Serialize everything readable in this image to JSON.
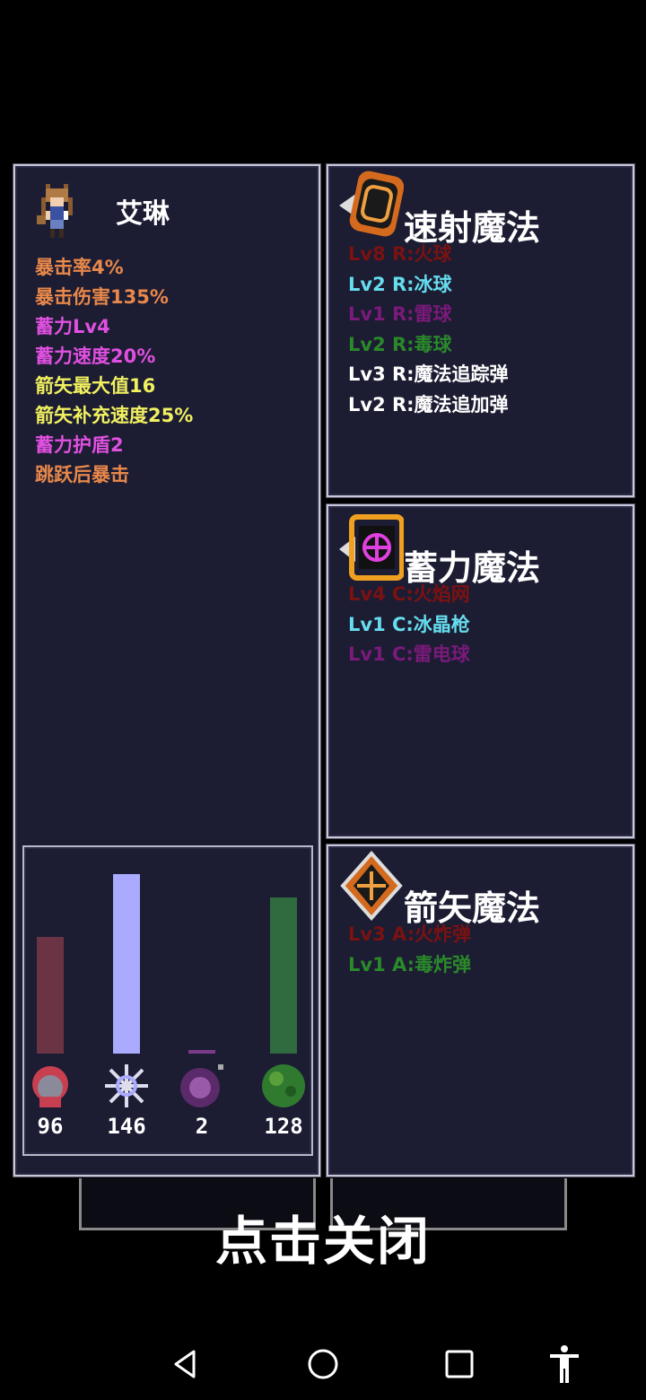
{
  "character": {
    "name": "艾琳",
    "stats": [
      {
        "text": "暴击率4%",
        "color": "#e8884a"
      },
      {
        "text": "暴击伤害135%",
        "color": "#e8884a"
      },
      {
        "text": "蓄力Lv4",
        "color": "#e050e0"
      },
      {
        "text": "蓄力速度20%",
        "color": "#e050e0"
      },
      {
        "text": "箭矢最大值16",
        "color": "#f0f060"
      },
      {
        "text": "箭矢补充速度25%",
        "color": "#f0f060"
      },
      {
        "text": "蓄力护盾2",
        "color": "#e050e0"
      },
      {
        "text": "跳跃后暴击",
        "color": "#e8884a"
      }
    ]
  },
  "elements": [
    {
      "icon": "fire-element-icon",
      "count": "96",
      "level": 0.65,
      "color": "#6b3444"
    },
    {
      "icon": "ice-element-icon",
      "count": "146",
      "level": 1.0,
      "color": "#aaaaff"
    },
    {
      "icon": "thunder-element-icon",
      "count": "2",
      "level": 0.02,
      "color": "#7a3c8a"
    },
    {
      "icon": "poison-element-icon",
      "count": "128",
      "level": 0.87,
      "color": "#2f6b3f"
    }
  ],
  "magic_groups": [
    {
      "title": "速射魔法",
      "icon": "rapid-fire-magic-icon",
      "spells": [
        {
          "text": "Lv8 R:火球",
          "color": "#7a1212"
        },
        {
          "text": "Lv2 R:冰球",
          "color": "#66ddee"
        },
        {
          "text": "Lv1 R:雷球",
          "color": "#7a1a7a"
        },
        {
          "text": "Lv2 R:毒球",
          "color": "#2a8a2a"
        },
        {
          "text": "Lv3 R:魔法追踪弹",
          "color": "#ffffff"
        },
        {
          "text": "Lv2 R:魔法追加弹",
          "color": "#ffffff"
        }
      ]
    },
    {
      "title": "蓄力魔法",
      "icon": "charge-magic-icon",
      "spells": [
        {
          "text": "Lv4 C:火焰网",
          "color": "#7a1212"
        },
        {
          "text": "Lv1 C:冰晶枪",
          "color": "#66ddee"
        },
        {
          "text": "Lv1 C:雷电球",
          "color": "#7a1a7a"
        }
      ]
    },
    {
      "title": "箭矢魔法",
      "icon": "arrow-magic-icon",
      "spells": [
        {
          "text": "Lv3 A:火炸弹",
          "color": "#7a1212"
        },
        {
          "text": "Lv1 A:毒炸弹",
          "color": "#2a8a2a"
        }
      ]
    }
  ],
  "close_label": "点击关闭",
  "navbar": [
    "back-icon",
    "home-icon",
    "recents-icon",
    "accessibility-icon"
  ]
}
